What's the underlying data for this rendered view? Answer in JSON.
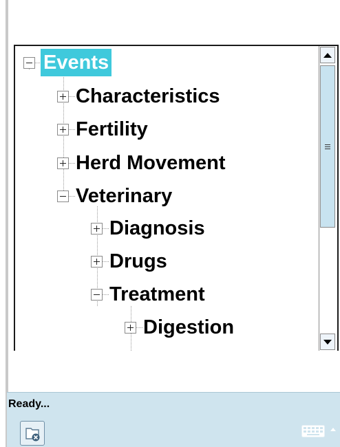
{
  "tree": {
    "root": {
      "label": "Events",
      "expanded": true,
      "selected": true
    },
    "level1": [
      {
        "label": "Characteristics",
        "expanded": false
      },
      {
        "label": "Fertility",
        "expanded": false
      },
      {
        "label": "Herd Movement",
        "expanded": false
      },
      {
        "label": "Veterinary",
        "expanded": true
      }
    ],
    "level2": [
      {
        "label": "Diagnosis",
        "expanded": false
      },
      {
        "label": "Drugs",
        "expanded": false
      },
      {
        "label": "Treatment",
        "expanded": true
      }
    ],
    "level3": [
      {
        "label": "Digestion",
        "expanded": false
      }
    ]
  },
  "status": {
    "text": "Ready..."
  },
  "icons": {
    "folder": "folder-close-icon",
    "keyboard": "keyboard-icon",
    "scroll_up": "scroll-up-arrow-icon",
    "scroll_down": "scroll-down-arrow-icon"
  },
  "colors": {
    "selection": "#3fc9dc",
    "status_bar": "#cfe4ee",
    "scroll_thumb": "#c8e3f0"
  }
}
